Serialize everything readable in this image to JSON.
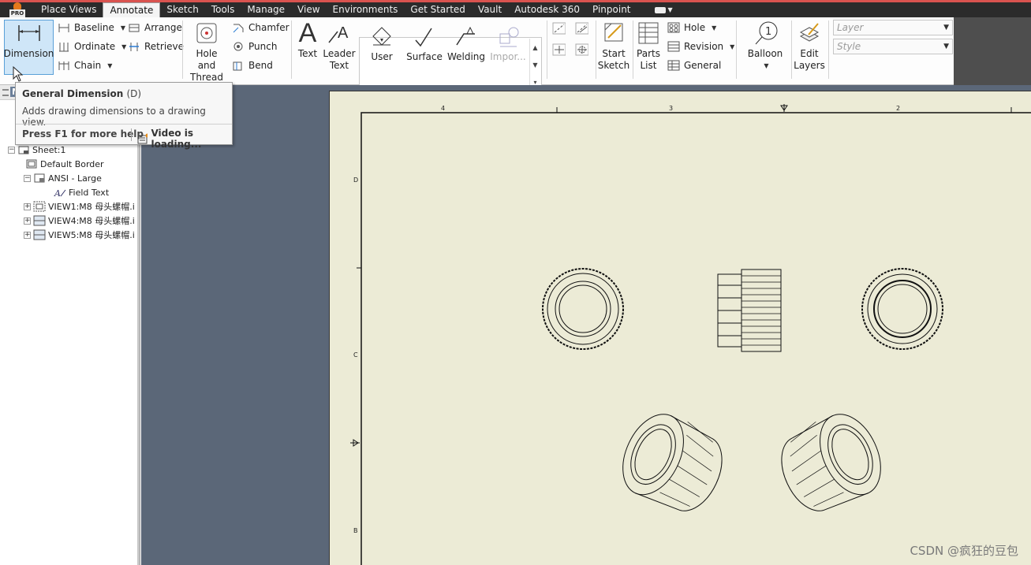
{
  "menu": {
    "logo_badge": "PRO",
    "tabs": [
      "Place Views",
      "Annotate",
      "Sketch",
      "Tools",
      "Manage",
      "View",
      "Environments",
      "Get Started",
      "Vault",
      "Autodesk 360",
      "Pinpoint"
    ],
    "active_tab": "Annotate"
  },
  "ribbon": {
    "dimension": {
      "label": "Dimension"
    },
    "dimension_tools": {
      "baseline": "Baseline",
      "ordinate": "Ordinate",
      "chain": "Chain",
      "arrange": "Arrange",
      "retrieve": "Retrieve"
    },
    "feature_notes": {
      "hole_thread_l1": "Hole and",
      "hole_thread_l2": "Thread",
      "chamfer": "Chamfer",
      "punch": "Punch",
      "bend": "Bend"
    },
    "text_tools": {
      "text": "Text",
      "leader_l1": "Leader",
      "leader_l2": "Text"
    },
    "symbols": {
      "user": "User",
      "surface": "Surface",
      "welding": "Welding",
      "import": "Impor..."
    },
    "sketch": {
      "start_l1": "Start",
      "start_l2": "Sketch"
    },
    "tables": {
      "parts_l1": "Parts",
      "parts_l2": "List",
      "hole": "Hole",
      "revision": "Revision",
      "general": "General"
    },
    "balloon": {
      "label": "Balloon",
      "number": "1"
    },
    "layers": {
      "edit_l1": "Edit",
      "edit_l2": "Layers"
    },
    "format": {
      "layer_placeholder": "Layer",
      "style_placeholder": "Style"
    }
  },
  "tooltip": {
    "title": "General Dimension",
    "shortcut": "(D)",
    "description": "Adds drawing dimensions to a drawing view.",
    "help": "Press F1 for more help",
    "video": "Video is loading..."
  },
  "browser": {
    "header_letter": "M",
    "items": {
      "sheet": "Sheet:1",
      "border": "Default Border",
      "title_block": "ANSI - Large",
      "field_text": "Field Text",
      "view1": "VIEW1:M8 母头螺帽.i",
      "view4": "VIEW4:M8 母头螺帽.i",
      "view5": "VIEW5:M8 母头螺帽.i"
    }
  },
  "drawing": {
    "top_zones": [
      "4",
      "3",
      "2"
    ],
    "left_zones": [
      "D",
      "C",
      "B"
    ]
  },
  "watermark": "CSDN @疯狂的豆包",
  "colors": {
    "menubar": "#2b2b2b",
    "accent_red": "#d9534f",
    "canvas": "#5b6778",
    "sheet": "#ecebd6",
    "selection": "#cfe6f8"
  }
}
